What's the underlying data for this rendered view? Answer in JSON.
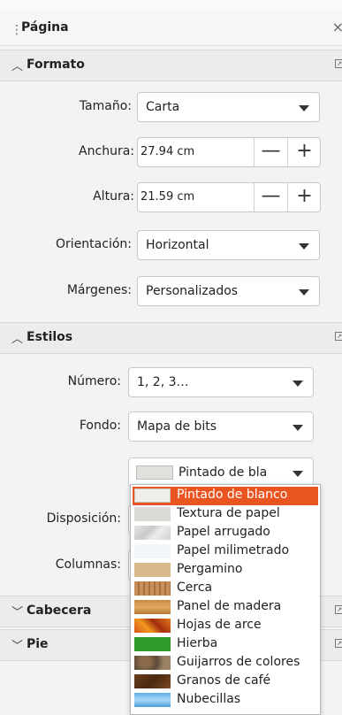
{
  "panel": {
    "title": "Página"
  },
  "sections": {
    "formato": "Formato",
    "estilos": "Estilos",
    "cabecera": "Cabecera",
    "pie": "Pie"
  },
  "formato": {
    "size_label": "Tamaño:",
    "size_value": "Carta",
    "width_label": "Anchura:",
    "width_value": "27.94 cm",
    "height_label": "Altura:",
    "height_value": "21.59 cm",
    "orientation_label": "Orientación:",
    "orientation_value": "Horizontal",
    "margins_label": "Márgenes:",
    "margins_value": "Personalizados"
  },
  "estilos": {
    "number_label": "Número:",
    "number_value": "1, 2, 3…",
    "background_label": "Fondo:",
    "background_value": "Mapa de bits",
    "bitmap_value": "Pintado de bla",
    "layout_label": "Disposición:",
    "columns_label": "Columnas:"
  },
  "spin": {
    "minus": "—",
    "plus": "+"
  },
  "bitmap_options": [
    {
      "label": "Pintado de blanco",
      "icon": "white-paint-swatch"
    },
    {
      "label": "Textura de papel",
      "icon": "paper-texture-swatch"
    },
    {
      "label": "Papel arrugado",
      "icon": "crumpled-paper-swatch"
    },
    {
      "label": "Papel milimetrado",
      "icon": "graph-paper-swatch"
    },
    {
      "label": "Pergamino",
      "icon": "parchment-swatch"
    },
    {
      "label": "Cerca",
      "icon": "fence-swatch"
    },
    {
      "label": "Panel de madera",
      "icon": "wood-panel-swatch"
    },
    {
      "label": "Hojas de arce",
      "icon": "maple-leaves-swatch"
    },
    {
      "label": "Hierba",
      "icon": "grass-swatch"
    },
    {
      "label": "Guijarros de colores",
      "icon": "pebbles-swatch"
    },
    {
      "label": "Granos de café",
      "icon": "coffee-beans-swatch"
    },
    {
      "label": "Nubecillas",
      "icon": "clouds-swatch"
    }
  ],
  "colors": {
    "accent": "#e95420"
  }
}
